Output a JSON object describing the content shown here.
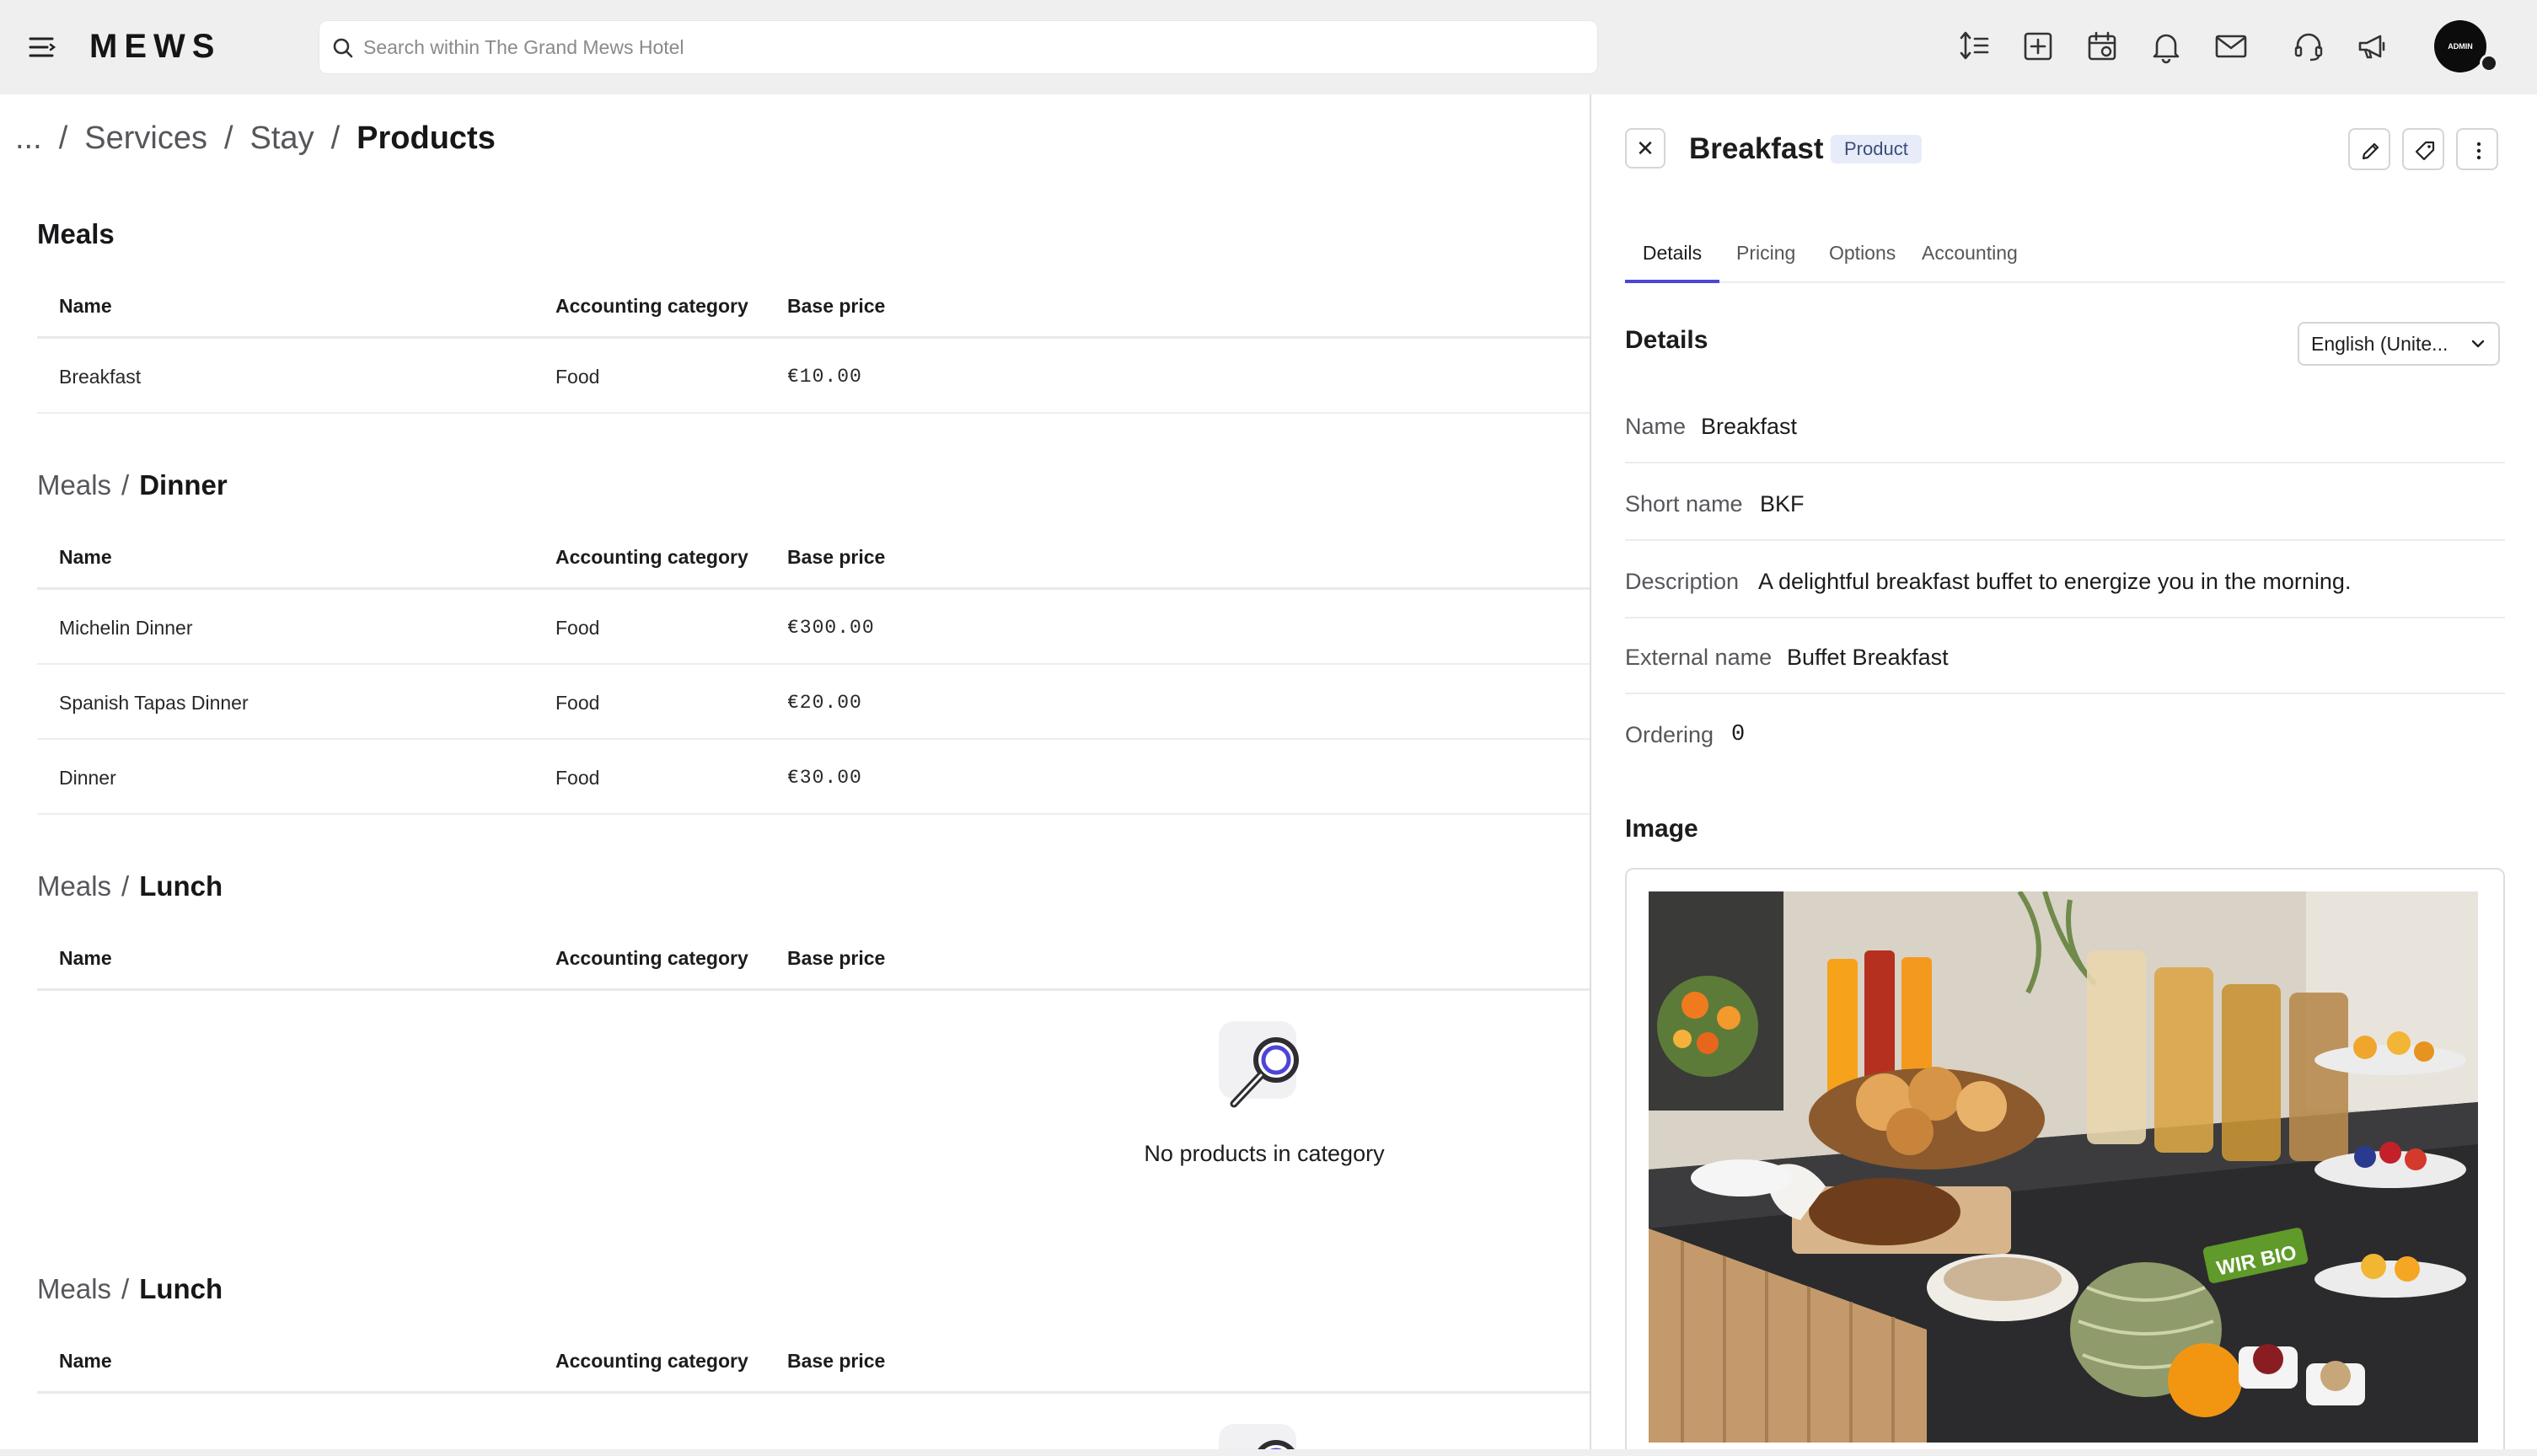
{
  "app": {
    "logo": "MEWS",
    "search_placeholder": "Search within The Grand Mews Hotel",
    "avatar_label": "ADMIN"
  },
  "topbar_icons": [
    "list-sort-icon",
    "add-square-icon",
    "calendar-icon",
    "bell-icon",
    "mail-icon",
    "headset-icon",
    "megaphone-icon"
  ],
  "breadcrumb": {
    "ellipsis": "...",
    "items": [
      "Services",
      "Stay"
    ],
    "current": "Products"
  },
  "table_headers": {
    "name": "Name",
    "category": "Accounting category",
    "price": "Base price"
  },
  "sections": [
    {
      "title": "Meals",
      "rows": [
        {
          "name": "Breakfast",
          "category": "Food",
          "price": "€10.00"
        }
      ]
    },
    {
      "parent": "Meals",
      "title": "Dinner",
      "rows": [
        {
          "name": "Michelin Dinner",
          "category": "Food",
          "price": "€300.00"
        },
        {
          "name": "Spanish Tapas Dinner",
          "category": "Food",
          "price": "€20.00"
        },
        {
          "name": "Dinner",
          "category": "Food",
          "price": "€30.00"
        }
      ]
    },
    {
      "parent": "Meals",
      "title": "Lunch",
      "rows": [],
      "empty_message": "No products in category"
    },
    {
      "parent": "Meals",
      "title": "Lunch",
      "rows": []
    }
  ],
  "separator": "/",
  "panel": {
    "title": "Breakfast",
    "badge": "Product",
    "close_label": "✕",
    "tabs": [
      "Details",
      "Pricing",
      "Options",
      "Accounting"
    ],
    "active_tab": "Details",
    "details_heading": "Details",
    "language": "English (Unite...",
    "fields": [
      {
        "label": "Name",
        "value": "Breakfast"
      },
      {
        "label": "Short name",
        "value": "BKF"
      },
      {
        "label": "Description",
        "value": "A delightful breakfast buffet to energize you in the morning."
      },
      {
        "label": "External name",
        "value": "Buffet Breakfast"
      },
      {
        "label": "Ordering",
        "value": "0"
      }
    ],
    "image_heading": "Image",
    "image_alt": "Breakfast buffet",
    "image_label": "WIR BIO"
  },
  "colors": {
    "accent": "#4d45d6",
    "topbar_bg": "#efefef",
    "badge_bg": "#e7ecf8",
    "muted_text": "#56565b"
  }
}
